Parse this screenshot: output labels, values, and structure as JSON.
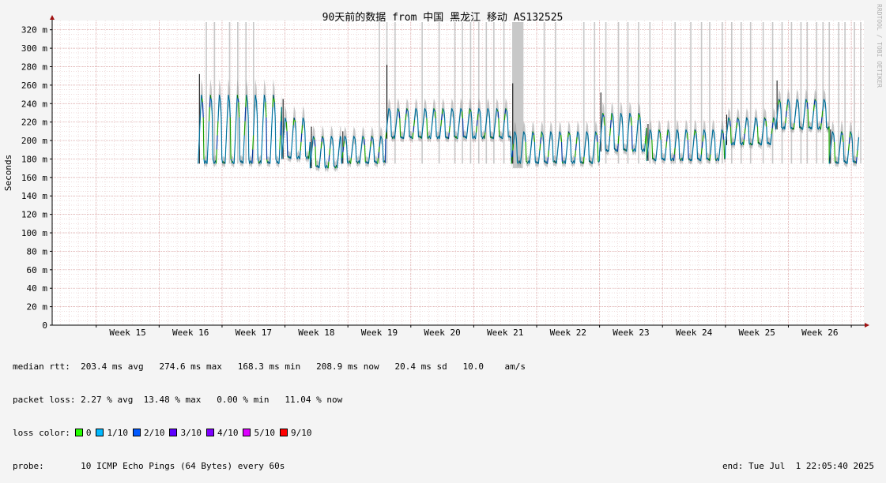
{
  "chart_data": {
    "type": "line",
    "title": "90天前的数据 from 中国 黑龙江 移动 AS132525",
    "ylabel": "Seconds",
    "ylim": [
      0,
      0.33
    ],
    "y_tick_labels": [
      "0",
      "20 m",
      "40 m",
      "60 m",
      "80 m",
      "100 m",
      "120 m",
      "140 m",
      "160 m",
      "180 m",
      "200 m",
      "220 m",
      "240 m",
      "260 m",
      "280 m",
      "300 m",
      "320 m"
    ],
    "x_tick_labels": [
      "Week 15",
      "Week 16",
      "Week 17",
      "Week 18",
      "Week 19",
      "Week 20",
      "Week 21",
      "Week 22",
      "Week 23",
      "Week 24",
      "Week 25",
      "Week 26"
    ],
    "x_range_weeks": [
      14.3,
      27.2
    ],
    "data_start_week": 16.62,
    "grid": true,
    "segments": [
      {
        "start_week": 16.62,
        "end_week": 17.95,
        "base": 0.175,
        "peak": 0.25,
        "spike": 0.272
      },
      {
        "start_week": 17.95,
        "end_week": 18.4,
        "base": 0.18,
        "peak": 0.225,
        "spike": 0.245
      },
      {
        "start_week": 18.4,
        "end_week": 18.9,
        "base": 0.17,
        "peak": 0.205,
        "spike": 0.215
      },
      {
        "start_week": 18.9,
        "end_week": 19.6,
        "base": 0.175,
        "peak": 0.205,
        "spike": 0.21
      },
      {
        "start_week": 19.6,
        "end_week": 21.6,
        "base": 0.202,
        "peak": 0.235,
        "spike": 0.282
      },
      {
        "start_week": 21.6,
        "end_week": 23.0,
        "base": 0.175,
        "peak": 0.21,
        "spike": 0.262
      },
      {
        "start_week": 23.0,
        "end_week": 23.75,
        "base": 0.188,
        "peak": 0.23,
        "spike": 0.252
      },
      {
        "start_week": 23.75,
        "end_week": 25.0,
        "base": 0.178,
        "peak": 0.212,
        "spike": 0.218
      },
      {
        "start_week": 25.0,
        "end_week": 25.8,
        "base": 0.195,
        "peak": 0.225,
        "spike": 0.228
      },
      {
        "start_week": 25.8,
        "end_week": 26.65,
        "base": 0.212,
        "peak": 0.245,
        "spike": 0.265
      },
      {
        "start_week": 26.65,
        "end_week": 27.12,
        "base": 0.175,
        "peak": 0.21,
        "spike": 0.212
      }
    ],
    "loss_weeks": [
      16.75,
      16.88,
      17.12,
      17.25,
      17.38,
      17.5,
      19.5,
      19.62,
      19.75,
      20.18,
      20.45,
      20.7,
      20.82,
      20.95,
      21.08,
      21.2,
      21.32,
      21.48,
      21.62,
      21.7,
      21.78,
      22.12,
      22.3,
      22.75,
      22.92,
      23.1,
      23.3,
      23.45,
      23.62,
      23.8,
      24.2,
      24.45,
      24.62,
      24.75,
      24.95,
      25.1,
      25.25,
      25.4,
      25.6,
      25.75,
      25.9,
      26.05,
      26.2,
      26.3,
      26.45,
      26.55,
      26.65,
      26.8,
      26.9,
      27.05,
      27.15
    ],
    "loss_band_weeks": [
      [
        21.62,
        21.78
      ]
    ],
    "loss_colors": {
      "0": "#26ff00",
      "1/10": "#00b8ff",
      "2/10": "#0059ff",
      "3/10": "#5e00ff",
      "4/10": "#7e00ff",
      "5/10": "#dd00ff",
      "9/10": "#ff0000"
    }
  },
  "stats": {
    "median_label": "median rtt:",
    "median_values": "203.4 ms avg   274.6 ms max   168.3 ms min   208.9 ms now   20.4 ms sd   10.0    am/s",
    "loss_label": "packet loss:",
    "loss_values": "2.27 % avg  13.48 % max   0.00 % min   11.04 % now",
    "color_label": "loss color:",
    "color_items": [
      "0",
      "1/10",
      "2/10",
      "3/10",
      "4/10",
      "5/10",
      "9/10"
    ],
    "probe_label": "probe:",
    "probe_value": "10 ICMP Echo Pings (64 Bytes) every 60s",
    "end_text": "end: Tue Jul  1 22:05:40 2025"
  },
  "watermark": "RRDTOOL / TOBI OETIKER"
}
